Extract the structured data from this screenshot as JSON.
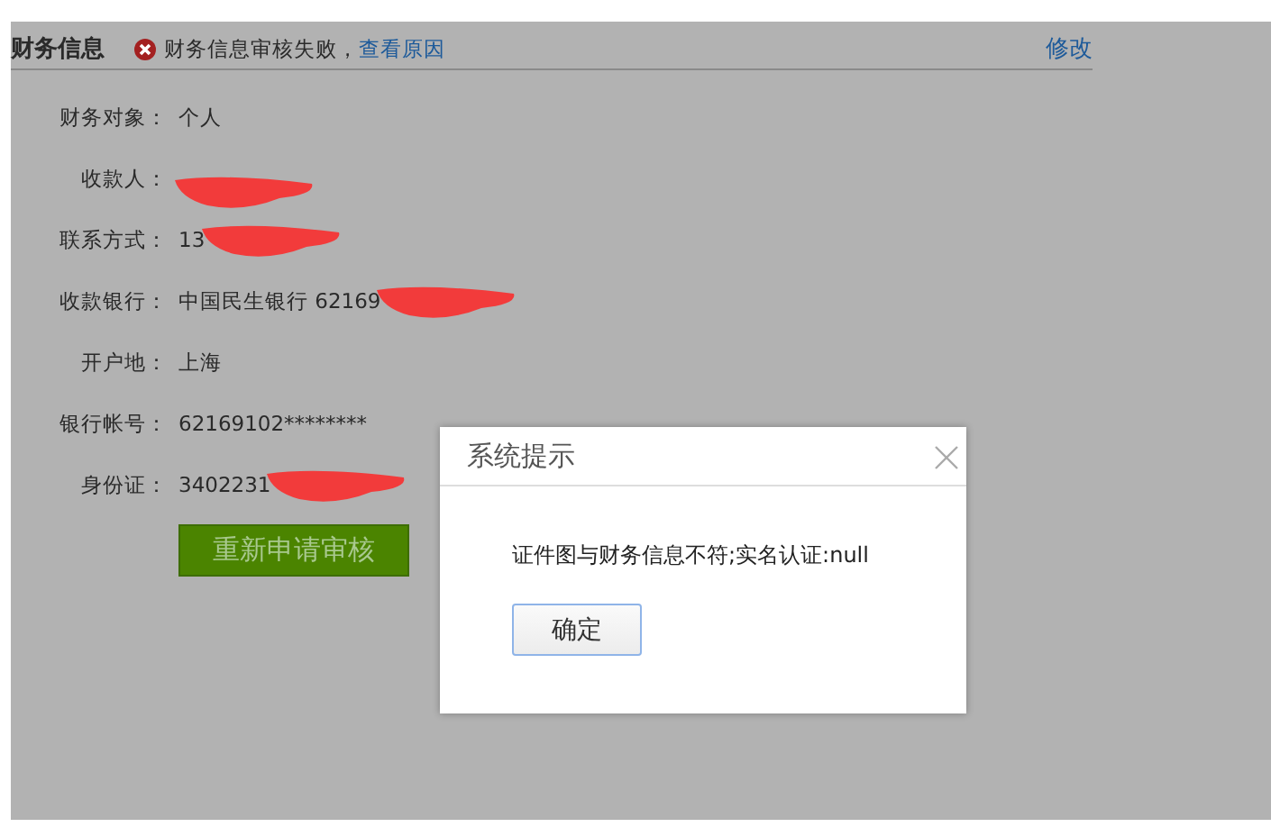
{
  "section": {
    "title": "财务信息",
    "status": "财务信息审核失败，",
    "status_link": "查看原因",
    "edit_link": "修改"
  },
  "fields": [
    {
      "label": "财务对象：",
      "value": "个人",
      "redacted": false
    },
    {
      "label": "收款人：",
      "redacted": true
    },
    {
      "label": "联系方式：",
      "value": "13",
      "redacted": true
    },
    {
      "label": "收款银行：",
      "value": "中国民生银行 62169",
      "redacted": true
    },
    {
      "label": "开户地：",
      "value": "上海",
      "redacted": false
    },
    {
      "label": "银行帐号：",
      "value": "62169102********",
      "redacted": false
    },
    {
      "label": "身份证：",
      "value": "3402231",
      "redacted": true
    }
  ],
  "resubmit_button": "重新申请审核",
  "dialog": {
    "title": "系统提示",
    "message": "证件图与财务信息不符;实名认证:null",
    "ok_button": "确定"
  }
}
